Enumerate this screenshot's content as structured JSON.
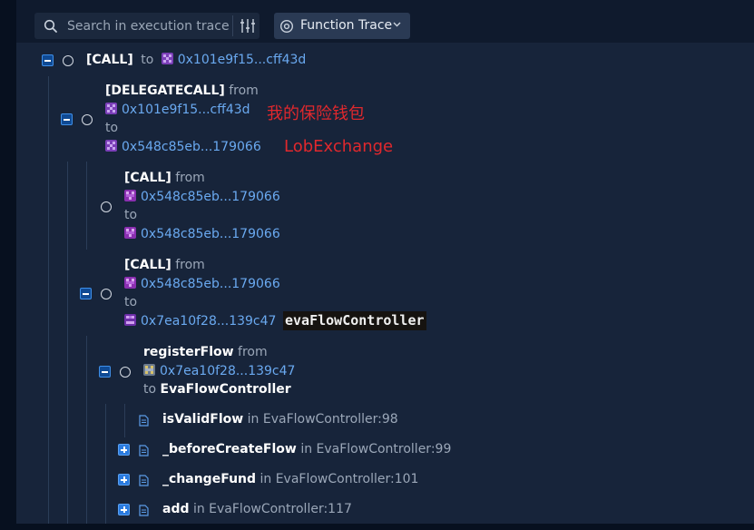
{
  "search": {
    "placeholder": "Search in execution trace"
  },
  "trace_mode": {
    "label": "Function Trace"
  },
  "annotations": {
    "wallet_note": "我的保险钱包",
    "exchange_note": "LobExchange",
    "controller_note": "evaFlowController"
  },
  "trace": {
    "root": {
      "type": "[CALL]",
      "to_word": "to",
      "to_addr": "0x101e9f15...cff43d"
    },
    "delegate": {
      "type": "[DELEGATECALL]",
      "from_word": "from",
      "from_addr": "0x101e9f15...cff43d",
      "to_word": "to",
      "to_addr": "0x548c85eb...179066"
    },
    "call1": {
      "type": "[CALL]",
      "from_word": "from",
      "from_addr": "0x548c85eb...179066",
      "to_word": "to",
      "to_addr": "0x548c85eb...179066"
    },
    "call2": {
      "type": "[CALL]",
      "from_word": "from",
      "from_addr": "0x548c85eb...179066",
      "to_word": "to",
      "to_addr": "0x7ea10f28...139c47"
    },
    "register": {
      "fn": "registerFlow",
      "from_word": "from",
      "from_addr": "0x7ea10f28...139c47",
      "to_word": "to",
      "to_contract": "EvaFlowController"
    },
    "internal": [
      {
        "fn": "isValidFlow",
        "in_word": "in",
        "loc": "EvaFlowController:98",
        "expandable": false
      },
      {
        "fn": "_beforeCreateFlow",
        "in_word": "in",
        "loc": "EvaFlowController:99",
        "expandable": true
      },
      {
        "fn": "_changeFund",
        "in_word": "in",
        "loc": "EvaFlowController:101",
        "expandable": true
      },
      {
        "fn": "add",
        "in_word": "in",
        "loc": "EvaFlowController:117",
        "expandable": true
      }
    ]
  },
  "colors": {
    "accent": "#3f8fe8",
    "address": "#6aa9f0",
    "annotation_red": "#e0282d",
    "panel": "#17243a",
    "background": "#0d1628"
  },
  "icons": {
    "search": "search-icon",
    "filter": "filter-sliders-icon",
    "trace_mode": "target-icon",
    "dropdown": "chevron-down-icon",
    "address_purple": "purple-identicon",
    "address_gray": "gray-identicon",
    "source_file": "document-icon"
  }
}
